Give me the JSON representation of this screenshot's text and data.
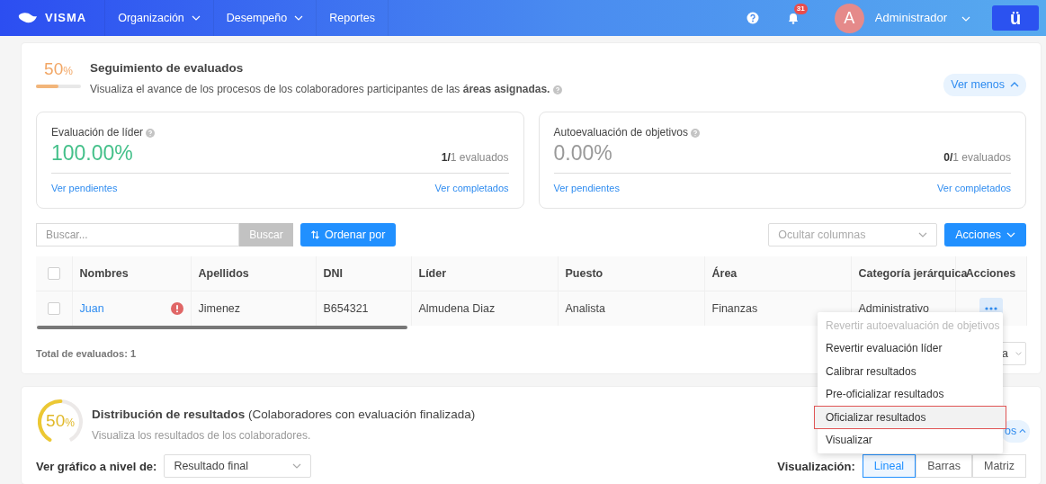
{
  "navbar": {
    "logo": "VISMA",
    "menu": [
      {
        "label": "Organización",
        "dropdown": true
      },
      {
        "label": "Desempeño",
        "dropdown": true
      },
      {
        "label": "Reportes",
        "dropdown": false
      }
    ],
    "notifications_badge": "31",
    "user": {
      "initial": "A",
      "name": "Administrador"
    },
    "app_button": "ü"
  },
  "tracking": {
    "percent": "50",
    "percent_sign": "%",
    "level": 0.5,
    "title": "Seguimiento de evaluados",
    "subtitle": "Visualiza el avance de los procesos de los colaboradores participantes de las **áreas asignadas.**",
    "toggle": "Ver menos",
    "expanded": true,
    "stats": [
      {
        "title": "Evaluación de líder",
        "value": "100.00%",
        "color": "#44c08a",
        "count": "**1/**1 evaluados",
        "links": [
          "Ver pendientes",
          "Ver completados"
        ]
      },
      {
        "title": "Autoevaluación de objetivos",
        "value": "0.00%",
        "color": "#999999",
        "count": "**0/**1 evaluados",
        "links": [
          "Ver pendientes",
          "Ver completados"
        ]
      }
    ]
  },
  "toolbar": {
    "search_placeholder": "Buscar...",
    "search_button": "Buscar",
    "sort_button": "Ordenar por",
    "columns_placeholder": "Ocultar columnas",
    "actions_button": "Acciones"
  },
  "table": {
    "header_checked": false,
    "columns": [
      "Nombres",
      "Apellidos",
      "DNI",
      "Líder",
      "Puesto",
      "Área",
      "Categoría jerárquica",
      "Acciones"
    ],
    "rows": [
      {
        "checked": false,
        "warning": true,
        "cells": [
          "Juan",
          "Jimenez",
          "B654321",
          "Almudena Diaz",
          "Analista",
          "Finanzas",
          "Administrativo"
        ]
      }
    ]
  },
  "total": "Total de evaluados: 1",
  "page_size_select": {
    "visible_text": "a"
  },
  "action_menu": {
    "items": [
      {
        "label": "Revertir autoevaluación de objetivos",
        "disabled": true,
        "highlighted": false
      },
      {
        "label": "Revertir evaluación líder",
        "disabled": false,
        "highlighted": false
      },
      {
        "label": "Calibrar resultados",
        "disabled": false,
        "highlighted": false
      },
      {
        "label": "Pre-oficializar resultados",
        "disabled": false,
        "highlighted": false
      },
      {
        "label": "Oficializar resultados",
        "disabled": false,
        "highlighted": true
      },
      {
        "label": "Visualizar",
        "disabled": false,
        "highlighted": false
      }
    ]
  },
  "distribution": {
    "percent": "50",
    "percent_sign": "%",
    "level": 0.5,
    "title": "**Distribución de resultados** (Colaboradores con evaluación finalizada)",
    "subtitle": "Visualiza los resultados de los colaboradores.",
    "toggle_visible_text": "os",
    "level_label": "Ver gráfico a nivel de:",
    "level_select": "Resultado final",
    "view_label": "Visualización:",
    "views": [
      {
        "label": "Lineal",
        "selected": true
      },
      {
        "label": "Barras",
        "selected": false
      },
      {
        "label": "Matriz",
        "selected": false
      }
    ]
  }
}
